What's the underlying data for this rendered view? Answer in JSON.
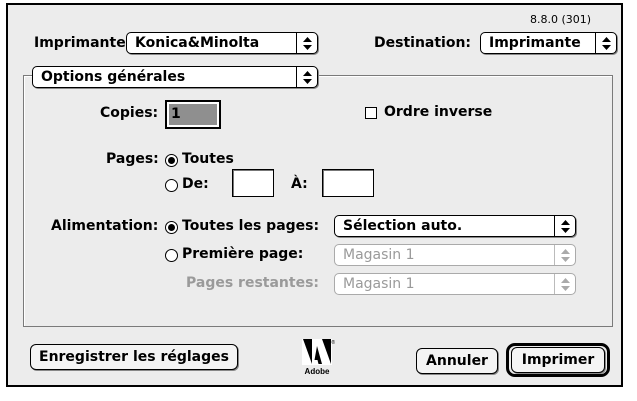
{
  "version": "8.8.0 (301)",
  "printer": {
    "label": "Imprimante:",
    "value": "Konica&Minolta"
  },
  "destination": {
    "label": "Destination:",
    "value": "Imprimante"
  },
  "panel": {
    "value": "Options générales"
  },
  "copies": {
    "label": "Copies:",
    "value": "1"
  },
  "reverse_order": {
    "label": "Ordre inverse",
    "checked": false
  },
  "pages": {
    "label": "Pages:",
    "all_label": "Toutes",
    "from_label": "De:",
    "to_label": "À:",
    "from_value": "",
    "to_value": "",
    "selected": "all"
  },
  "paper_source": {
    "label": "Alimentation:",
    "all_pages_label": "Toutes les pages:",
    "all_pages_value": "Sélection auto.",
    "first_page_label": "Première page:",
    "first_page_value": "Magasin 1",
    "remaining_label": "Pages restantes:",
    "remaining_value": "Magasin 1",
    "selected": "all_pages"
  },
  "buttons": {
    "save": "Enregistrer les réglages",
    "cancel": "Annuler",
    "print": "Imprimer"
  },
  "logo": {
    "name": "adobe-logo",
    "text": "Adobe"
  },
  "icons": {
    "popup_arrows": "updown-arrows-icon"
  }
}
